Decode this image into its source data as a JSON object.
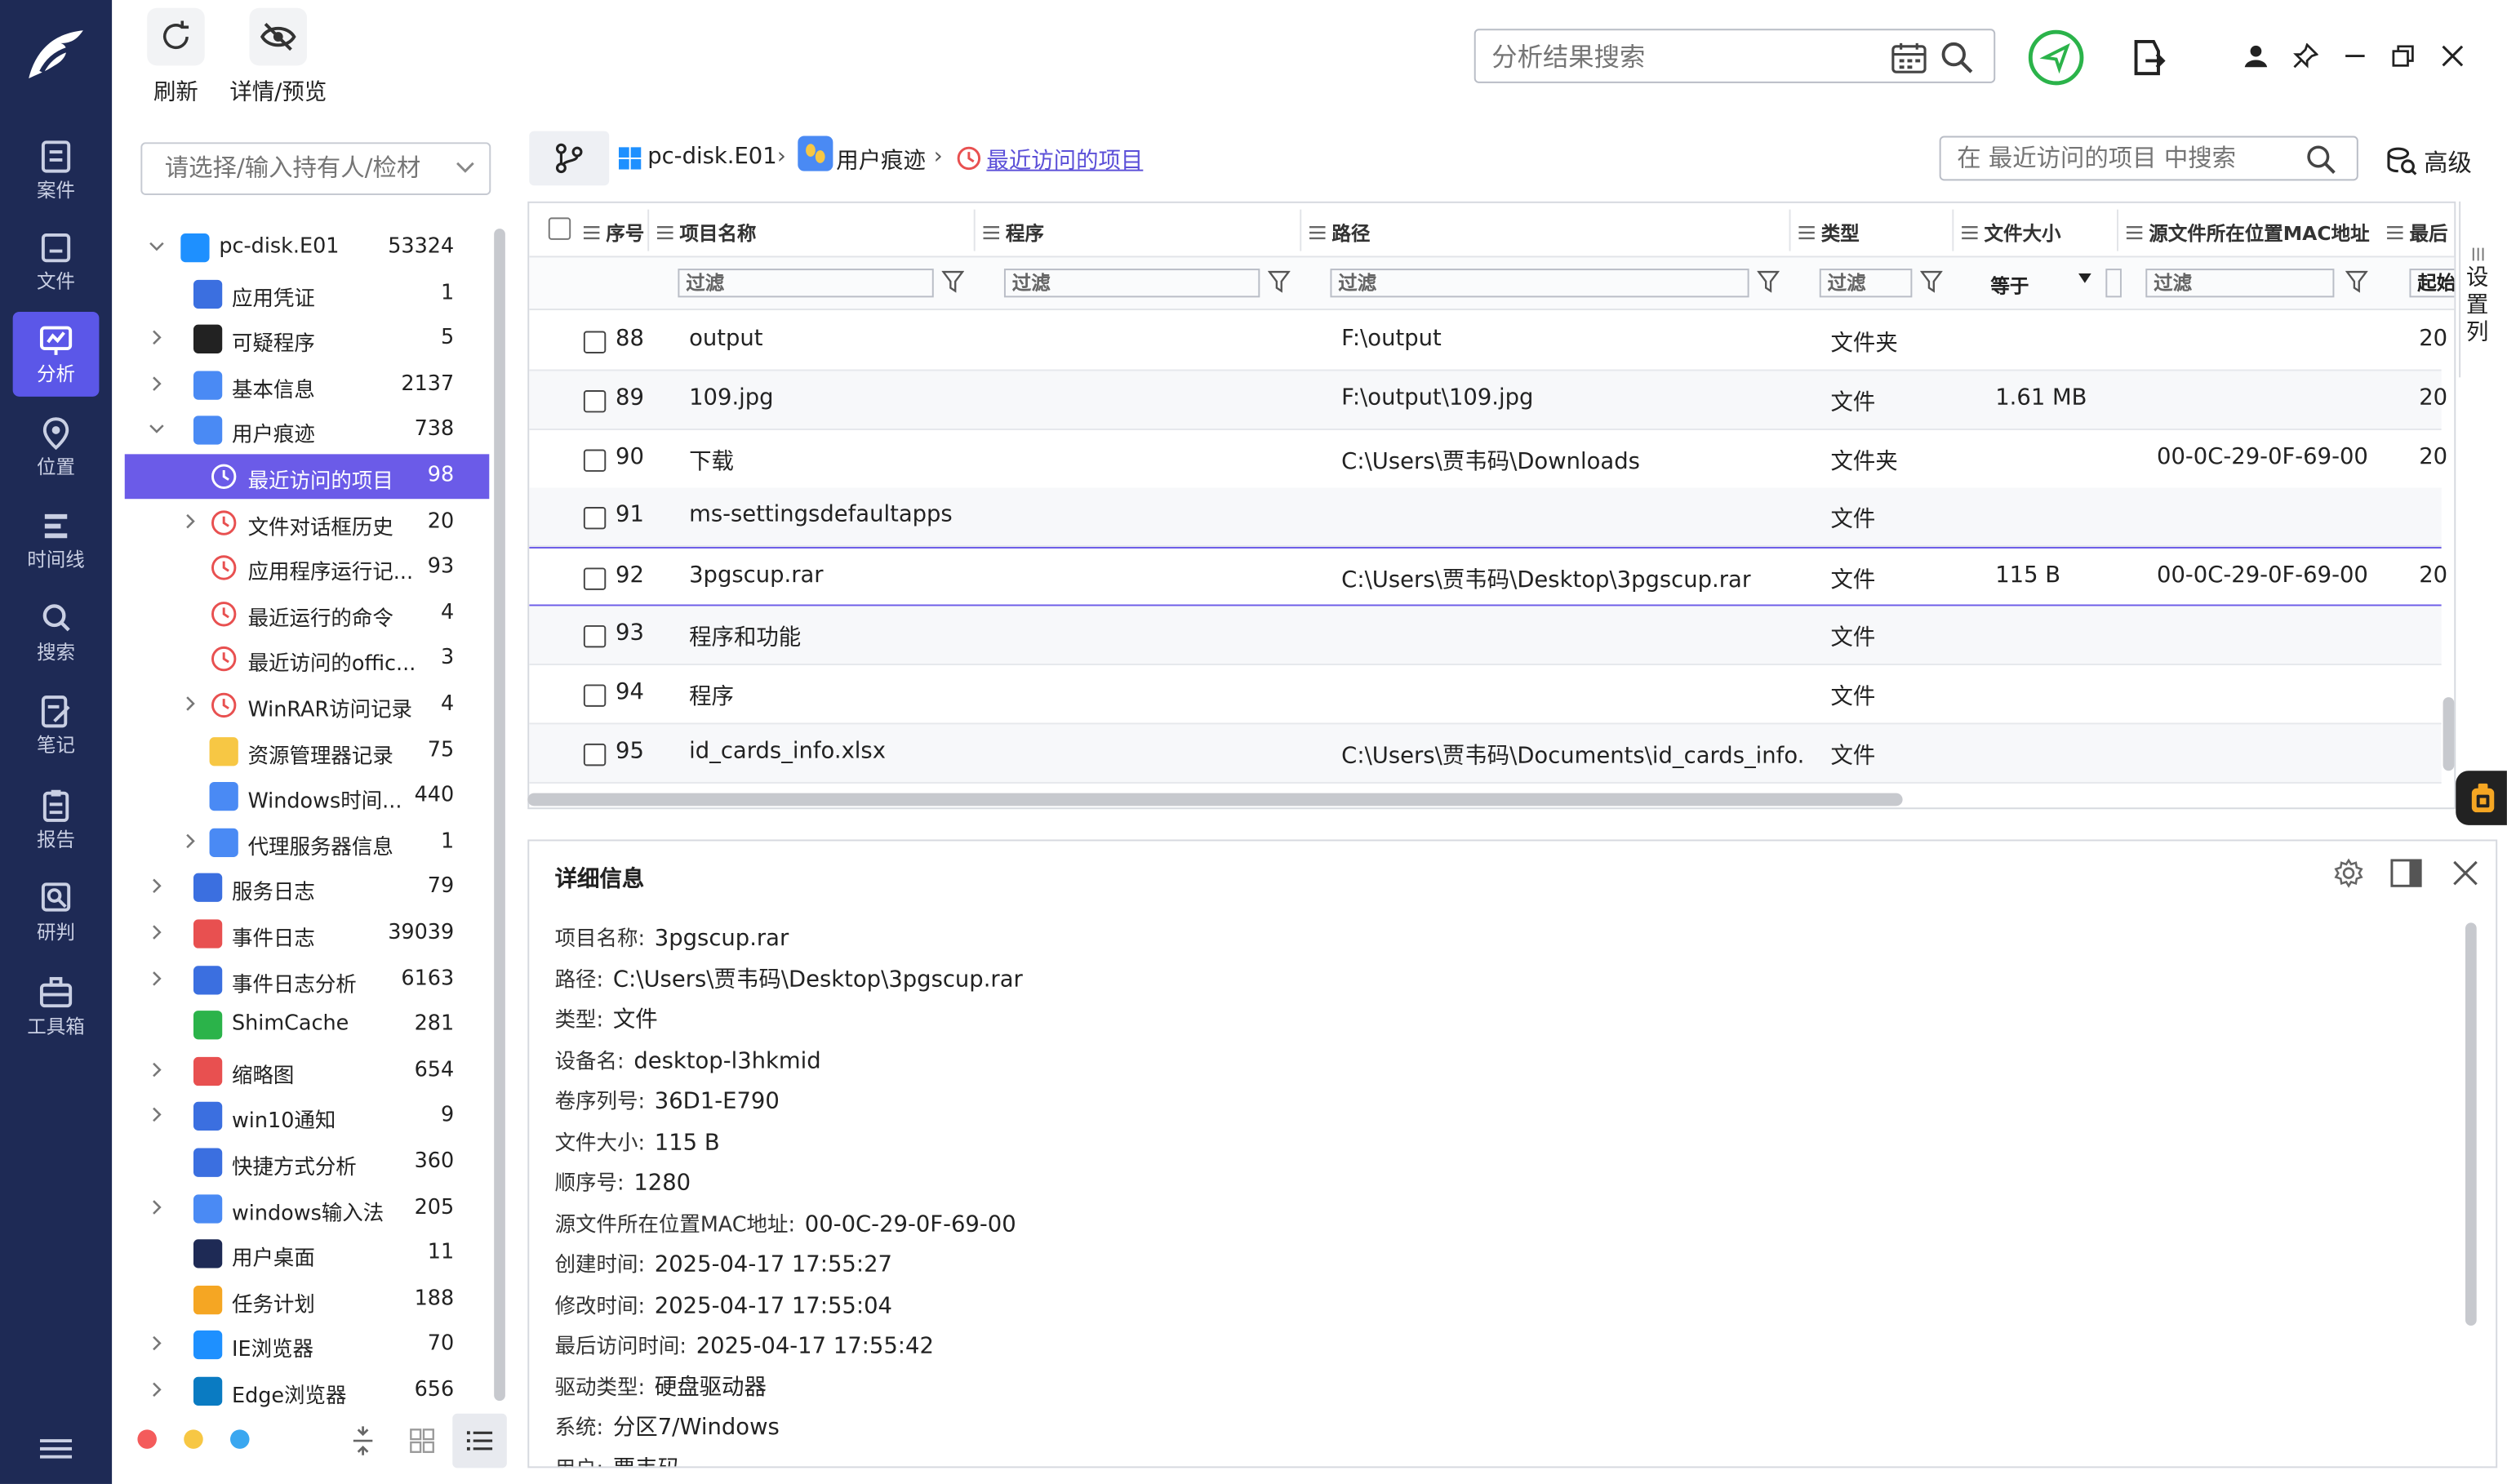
{
  "nav": {
    "items": [
      {
        "label": "案件",
        "icon": "case-icon"
      },
      {
        "label": "文件",
        "icon": "folder-icon"
      },
      {
        "label": "分析",
        "icon": "analysis-icon",
        "active": true
      },
      {
        "label": "位置",
        "icon": "location-icon"
      },
      {
        "label": "时间线",
        "icon": "timeline-icon"
      },
      {
        "label": "搜索",
        "icon": "search-icon"
      },
      {
        "label": "笔记",
        "icon": "note-icon"
      },
      {
        "label": "报告",
        "icon": "report-icon"
      },
      {
        "label": "研判",
        "icon": "judge-icon"
      },
      {
        "label": "工具箱",
        "icon": "toolbox-icon"
      }
    ]
  },
  "toolbar": {
    "refresh_label": "刷新",
    "detail_preview_label": "详情/预览"
  },
  "top_search": {
    "placeholder": "分析结果搜索"
  },
  "sidebar": {
    "holder_placeholder": "请选择/输入持有人/检材",
    "tree": [
      {
        "label": "pc-disk.E01",
        "count": "53324"
      },
      {
        "label": "应用凭证",
        "count": "1"
      },
      {
        "label": "可疑程序",
        "count": "5"
      },
      {
        "label": "基本信息",
        "count": "2137"
      },
      {
        "label": "用户痕迹",
        "count": "738"
      },
      {
        "label": "最近访问的项目",
        "count": "98"
      },
      {
        "label": "文件对话框历史",
        "count": "20"
      },
      {
        "label": "应用程序运行记...",
        "count": "93"
      },
      {
        "label": "最近运行的命令",
        "count": "4"
      },
      {
        "label": "最近访问的offic...",
        "count": "3"
      },
      {
        "label": "WinRAR访问记录",
        "count": "4"
      },
      {
        "label": "资源管理器记录",
        "count": "75"
      },
      {
        "label": "Windows时间...",
        "count": "440"
      },
      {
        "label": "代理服务器信息",
        "count": "1"
      },
      {
        "label": "服务日志",
        "count": "79"
      },
      {
        "label": "事件日志",
        "count": "39039"
      },
      {
        "label": "事件日志分析",
        "count": "6163"
      },
      {
        "label": "ShimCache",
        "count": "281"
      },
      {
        "label": "缩略图",
        "count": "654"
      },
      {
        "label": "win10通知",
        "count": "9"
      },
      {
        "label": "快捷方式分析",
        "count": "360"
      },
      {
        "label": "windows输入法",
        "count": "205"
      },
      {
        "label": "用户桌面",
        "count": "11"
      },
      {
        "label": "任务计划",
        "count": "188"
      },
      {
        "label": "IE浏览器",
        "count": "70"
      },
      {
        "label": "Edge浏览器",
        "count": "656"
      }
    ]
  },
  "breadcrumb": {
    "items": [
      "pc-disk.E01",
      "用户痕迹",
      "最近访问的项目"
    ],
    "sep": "›",
    "search_placeholder": "在 最近访问的项目 中搜索",
    "advanced_label": "高级"
  },
  "grid": {
    "columns": [
      "序号",
      "项目名称",
      "程序",
      "路径",
      "类型",
      "文件大小",
      "源文件所在位置MAC地址",
      "最后"
    ],
    "filter_placeholder": "过滤",
    "size_op": "等于",
    "last_filter": "起始",
    "rows": [
      {
        "seq": "88",
        "name": "output",
        "program": "",
        "path": "F:\\output",
        "type": "文件夹",
        "size": "",
        "mac": "",
        "last": "20"
      },
      {
        "seq": "89",
        "name": "109.jpg",
        "program": "",
        "path": "F:\\output\\109.jpg",
        "type": "文件",
        "size": "1.61 MB",
        "mac": "",
        "last": "20"
      },
      {
        "seq": "90",
        "name": "下载",
        "program": "",
        "path": "C:\\Users\\贾韦码\\Downloads",
        "type": "文件夹",
        "size": "",
        "mac": "00-0C-29-0F-69-00",
        "last": "20"
      },
      {
        "seq": "91",
        "name": "ms-settingsdefaultapps",
        "program": "",
        "path": "",
        "type": "文件",
        "size": "",
        "mac": "",
        "last": ""
      },
      {
        "seq": "92",
        "name": "3pgscup.rar",
        "program": "",
        "path": "C:\\Users\\贾韦码\\Desktop\\3pgscup.rar",
        "type": "文件",
        "size": "115 B",
        "mac": "00-0C-29-0F-69-00",
        "last": "20"
      },
      {
        "seq": "93",
        "name": "程序和功能",
        "program": "",
        "path": "",
        "type": "文件",
        "size": "",
        "mac": "",
        "last": ""
      },
      {
        "seq": "94",
        "name": "程序",
        "program": "",
        "path": "",
        "type": "文件",
        "size": "",
        "mac": "",
        "last": ""
      },
      {
        "seq": "95",
        "name": "id_cards_info.xlsx",
        "program": "",
        "path": "C:\\Users\\贾韦码\\Documents\\id_cards_info....",
        "type": "文件",
        "size": "",
        "mac": "",
        "last": ""
      }
    ],
    "set_columns_label": [
      "设",
      "置",
      "列"
    ]
  },
  "detail": {
    "title": "详细信息",
    "fields": [
      {
        "key": "项目名称:",
        "value": "3pgscup.rar"
      },
      {
        "key": "路径:",
        "value": "C:\\Users\\贾韦码\\Desktop\\3pgscup.rar"
      },
      {
        "key": "类型:",
        "value": "文件"
      },
      {
        "key": "设备名:",
        "value": "desktop-l3hkmid"
      },
      {
        "key": "卷序列号:",
        "value": "36D1-E790"
      },
      {
        "key": "文件大小:",
        "value": "115 B"
      },
      {
        "key": "顺序号:",
        "value": "1280"
      },
      {
        "key": "源文件所在位置MAC地址:",
        "value": "00-0C-29-0F-69-00"
      },
      {
        "key": "创建时间:",
        "value": "2025-04-17 17:55:27"
      },
      {
        "key": "修改时间:",
        "value": "2025-04-17 17:55:04"
      },
      {
        "key": "最后访问时间:",
        "value": "2025-04-17 17:55:42"
      },
      {
        "key": "驱动类型:",
        "value": "硬盘驱动器"
      },
      {
        "key": "系统:",
        "value": "分区7/Windows"
      },
      {
        "key": "用户:",
        "value": "贾韦码"
      }
    ]
  },
  "colors": {
    "nav_bg": "#1e2a55",
    "accent": "#6b5be8",
    "green": "#2bb34a"
  }
}
